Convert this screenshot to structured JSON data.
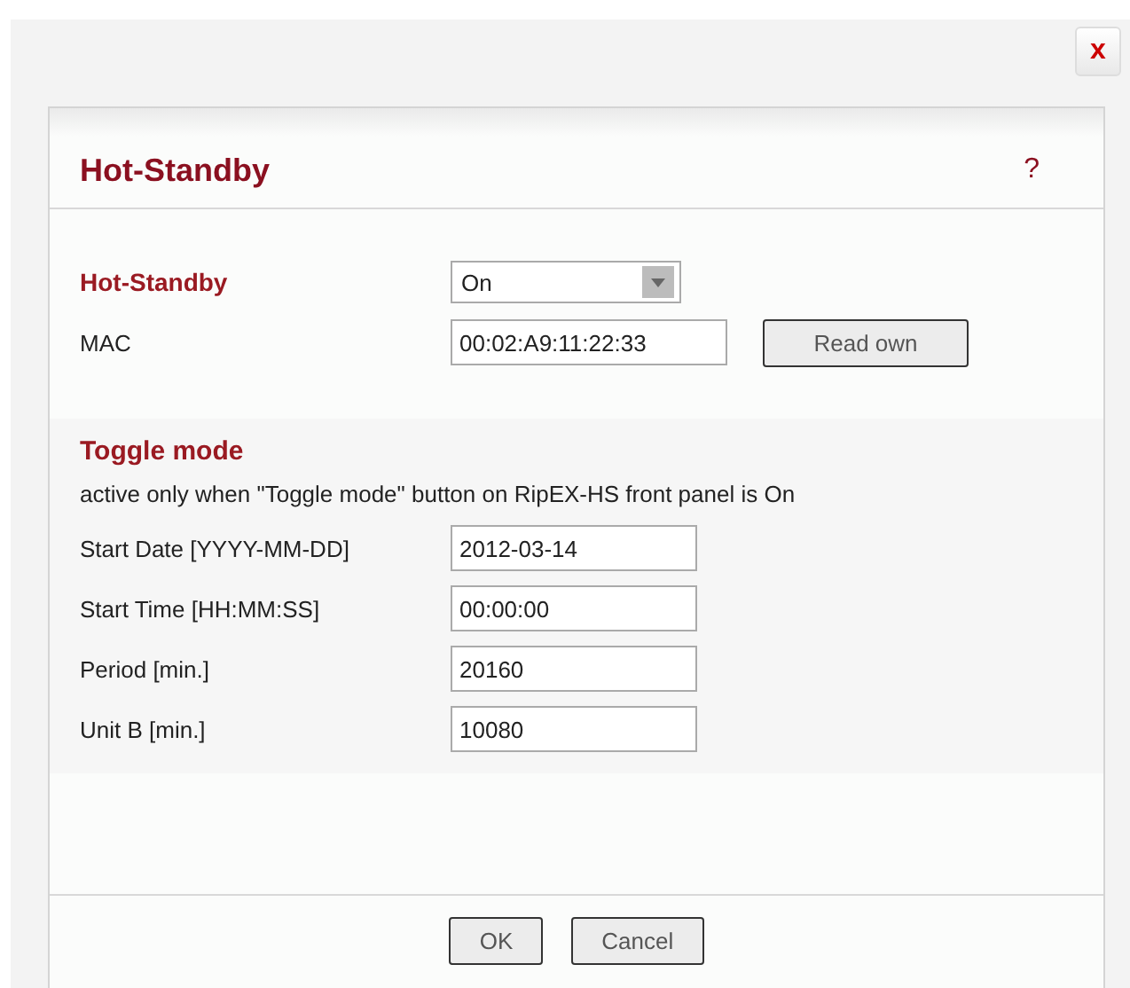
{
  "close_button": {
    "label": "x"
  },
  "dialog": {
    "title": "Hot-Standby",
    "help": "?"
  },
  "main_section": {
    "rows": [
      {
        "kind": "select",
        "label": "Hot-Standby",
        "emphasis": true,
        "value": "On"
      },
      {
        "kind": "input-button",
        "label": "MAC",
        "emphasis": false,
        "value": "00:02:A9:11:22:33",
        "button": "Read own"
      }
    ]
  },
  "toggle_section": {
    "title": "Toggle mode",
    "note": "active only when \"Toggle mode\" button on RipEX-HS front panel is On",
    "rows": [
      {
        "kind": "input",
        "label": "Start Date [YYYY-MM-DD]",
        "emphasis": false,
        "value": "2012-03-14"
      },
      {
        "kind": "input",
        "label": "Start Time [HH:MM:SS]",
        "emphasis": false,
        "value": "00:00:00"
      },
      {
        "kind": "input",
        "label": "Period [min.]",
        "emphasis": false,
        "value": "20160"
      },
      {
        "kind": "input",
        "label": "Unit B [min.]",
        "emphasis": false,
        "value": "10080"
      }
    ]
  },
  "buttons": [
    "OK",
    "Cancel"
  ]
}
